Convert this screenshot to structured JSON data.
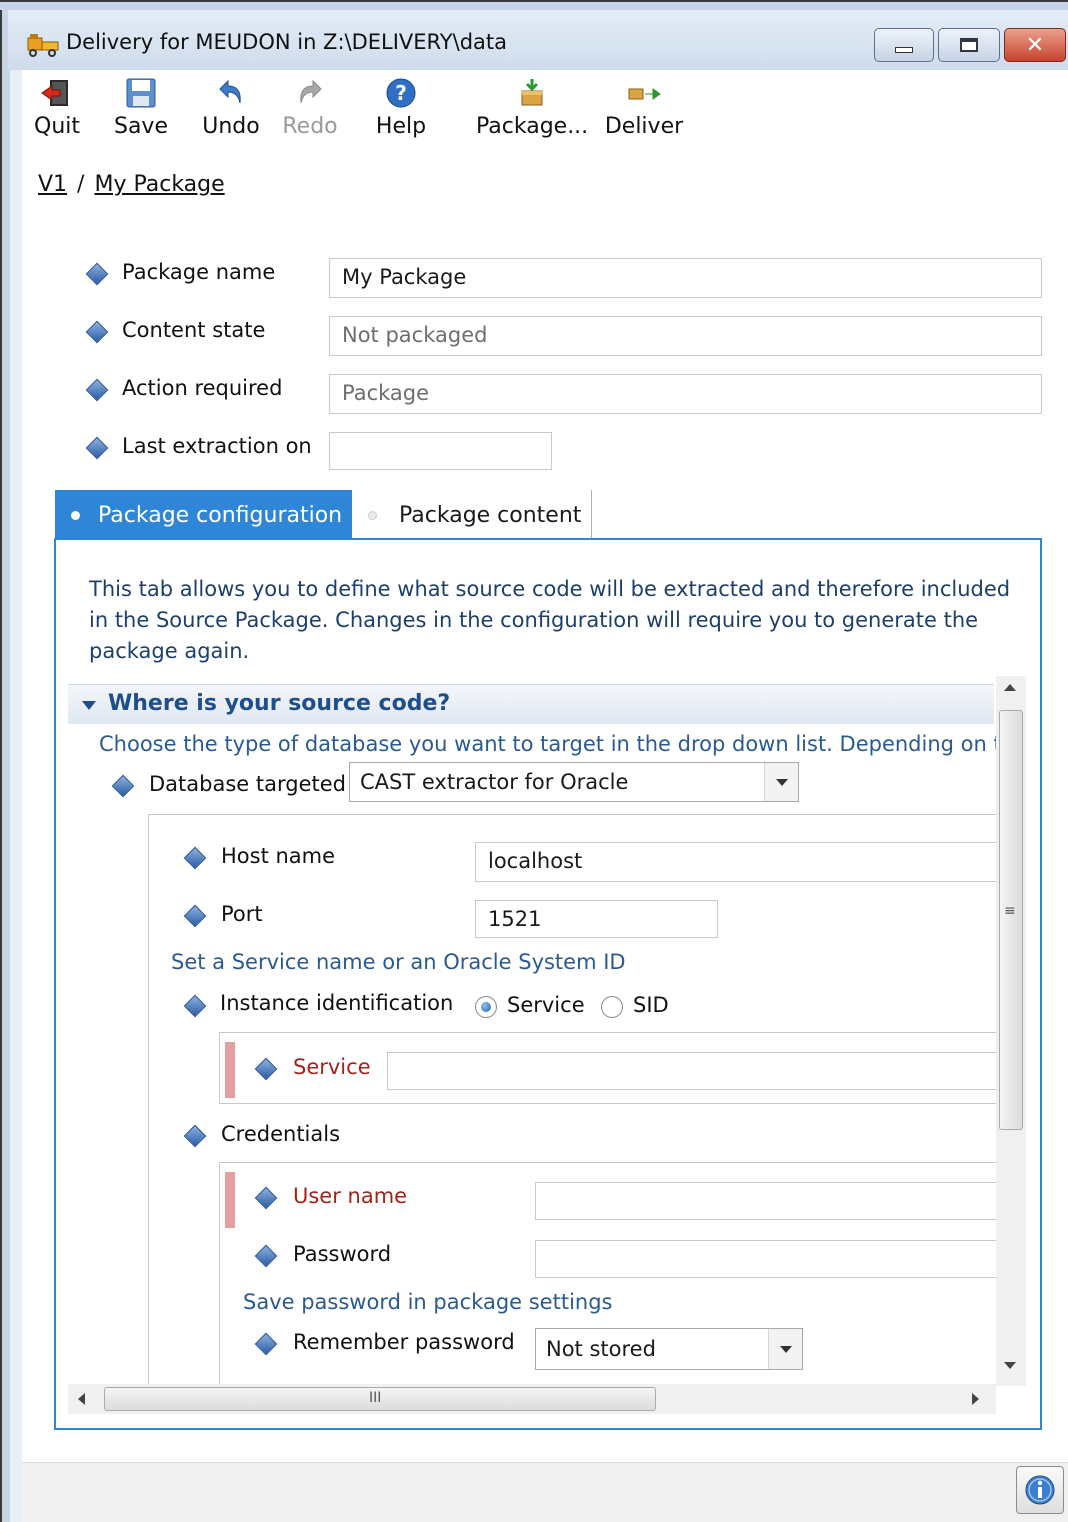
{
  "window": {
    "title": "Delivery for MEUDON in Z:\\DELIVERY\\data",
    "icon": "truck-icon",
    "controls": [
      "minimize-icon",
      "maximize-icon",
      "close-icon"
    ]
  },
  "toolbar": {
    "quit": {
      "label": "Quit",
      "icon": "exit-door-icon"
    },
    "save": {
      "label": "Save",
      "icon": "floppy-disk-icon"
    },
    "undo": {
      "label": "Undo",
      "icon": "undo-arrow-icon"
    },
    "redo": {
      "label": "Redo",
      "icon": "redo-arrow-icon",
      "disabled": true
    },
    "help": {
      "label": "Help",
      "icon": "help-question-icon"
    },
    "package": {
      "label": "Package...",
      "icon": "package-box-icon"
    },
    "deliver": {
      "label": "Deliver",
      "icon": "deliver-arrow-icon"
    }
  },
  "breadcrumb": {
    "root": "V1",
    "separator": "/",
    "current": "My Package"
  },
  "form": {
    "package_name": {
      "label": "Package name",
      "value": "My Package"
    },
    "content_state": {
      "label": "Content state",
      "value": "Not packaged"
    },
    "action_required": {
      "label": "Action required",
      "value": "Package"
    },
    "last_extraction": {
      "label": "Last extraction on",
      "value": ""
    }
  },
  "tabs": [
    {
      "label": "Package configuration",
      "active": true
    },
    {
      "label": "Package content",
      "active": false
    }
  ],
  "config": {
    "intro": "This tab allows you to define what source code will be extracted and therefore included in the Source Package. Changes in the configuration will require you to generate the package again.",
    "section_title": "Where is your source code?",
    "section_hint": "Choose the type of database you want to target in the drop down list. Depending on t",
    "database_label": "Database targeted",
    "database_value": "CAST extractor for Oracle",
    "host_label": "Host name",
    "host_value": "localhost",
    "port_label": "Port",
    "port_value": "1521",
    "service_hint": "Set a Service name or an Oracle System ID",
    "instance_label": "Instance identification",
    "radio_service": "Service",
    "radio_sid": "SID",
    "instance_selected": "Service",
    "service_label": "Service",
    "service_value": "",
    "credentials_label": "Credentials",
    "username_label": "User name",
    "username_value": "",
    "password_label": "Password",
    "password_value": "",
    "password_hint": "Save password in package settings",
    "remember_label": "Remember password",
    "remember_value": "Not stored"
  },
  "colors": {
    "accent": "#2f86d6",
    "required": "#a3231d",
    "hint": "#2a5a92"
  },
  "hscroll_grip": "III",
  "vscroll_grip": "≡"
}
